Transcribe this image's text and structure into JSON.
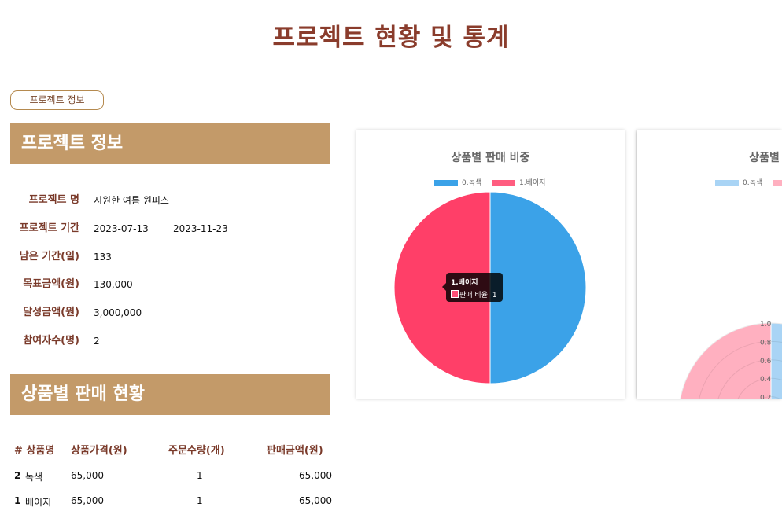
{
  "page": {
    "title": "프로젝트 현황 및 통계"
  },
  "tab": {
    "label": "프로젝트 정보"
  },
  "project_section": {
    "heading": "프로젝트 정보",
    "rows": [
      {
        "label": "프로젝트 명",
        "value": "시원한 여름 원피스"
      },
      {
        "label": "프로젝트 기간",
        "value": "2023-07-13",
        "value2": "2023-11-23"
      },
      {
        "label": "남은 기간(일)",
        "value": "133"
      },
      {
        "label": "목표금액(원)",
        "value": "130,000"
      },
      {
        "label": "달성금액(원)",
        "value": "3,000,000"
      },
      {
        "label": "참여자수(명)",
        "value": "2"
      }
    ]
  },
  "sales_section": {
    "heading": "상품별 판매 현황",
    "columns": [
      "# 상품명",
      "상품가격(원)",
      "주문수량(개)",
      "판매금액(원)"
    ],
    "rows": [
      {
        "no": "2",
        "name": "녹색",
        "price": "65,000",
        "qty": "1",
        "amount": "65,000"
      },
      {
        "no": "1",
        "name": "베이지",
        "price": "65,000",
        "qty": "1",
        "amount": "65,000"
      }
    ]
  },
  "colors": {
    "accent": "#8a3c2c",
    "banner": "#c39a69",
    "pie_blue": "#3ba2e8",
    "pie_red": "#ff3f68"
  },
  "chart_data": [
    {
      "type": "pie",
      "title": "상품별 판매 비중",
      "categories": [
        "0.녹색",
        "1.베이지"
      ],
      "values": [
        1,
        1
      ],
      "colors": [
        "#3ba2e8",
        "#ff3f68"
      ],
      "legend": "top",
      "tooltip": {
        "title": "1.베이지",
        "label": "판매 비율: 1"
      }
    },
    {
      "type": "polarArea",
      "title": "상품별 판",
      "categories": [
        "0.녹색"
      ],
      "values": [
        1,
        1
      ],
      "colors": [
        "#a9d4f5",
        "#ffb0c0"
      ],
      "legend": "top",
      "radial_ticks": [
        "1.0",
        "0.8",
        "0.6",
        "0.4",
        "0.2"
      ]
    }
  ]
}
